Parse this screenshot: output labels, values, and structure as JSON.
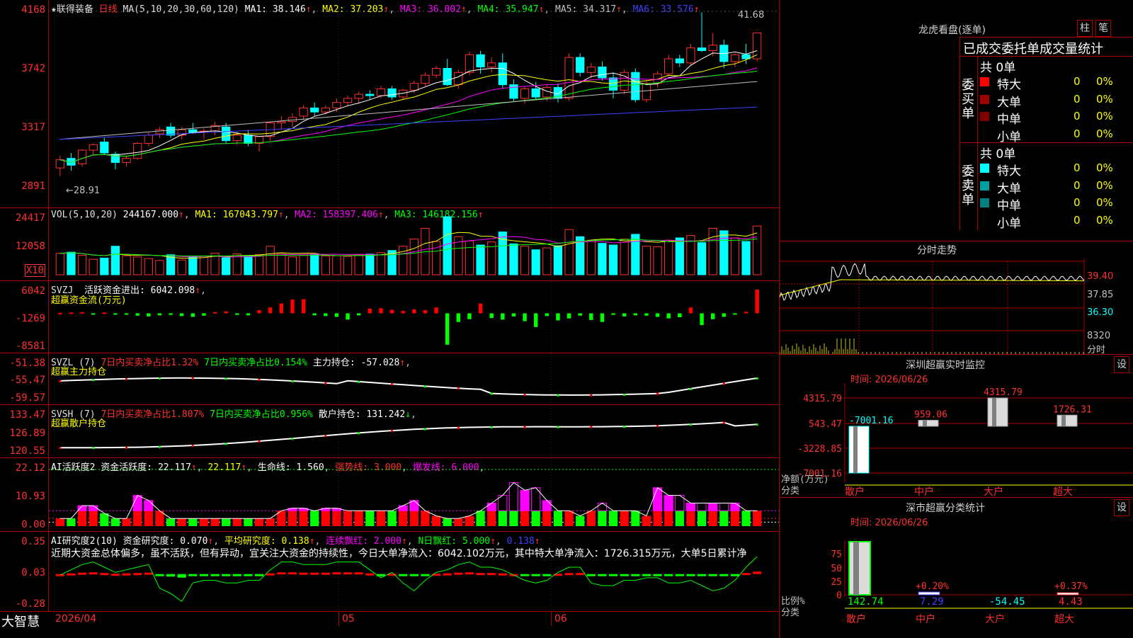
{
  "stock": {
    "name": "★联得装备",
    "period": "日线"
  },
  "ma_header": {
    "label": "MA(5,10,20,30,60,120)",
    "items": [
      {
        "text": "MA1: 38.146",
        "color": "#ffffff"
      },
      {
        "text": "MA2: 37.203",
        "color": "#ffff00"
      },
      {
        "text": "MA3: 36.002",
        "color": "#ff00ff"
      },
      {
        "text": "MA4: 35.947",
        "color": "#00ff00"
      },
      {
        "text": "MA5: 34.317",
        "color": "#c0c0c0"
      },
      {
        "text": "MA6: 33.576",
        "color": "#4040ff"
      }
    ],
    "high_label": "41.68",
    "low_label": "←28.91"
  },
  "price_axis": [
    "4168",
    "3742",
    "3317",
    "2891"
  ],
  "vol_header": {
    "label": "VOL(5,10,20)",
    "value": "244167.000",
    "ma1": "MA1: 167043.797",
    "ma2": "MA2: 158397.406",
    "ma3": "MA3: 146182.156"
  },
  "vol_axis": [
    "24417",
    "12058"
  ],
  "vol_unit": "X10",
  "svzj": {
    "label": "SVZJ",
    "line": "活跃资金进出: 6042.098",
    "sub": "超赢资金流(万元)",
    "axis": [
      "6042",
      "-1269",
      "-8581"
    ]
  },
  "svzl": {
    "label": "SVZL (7)",
    "a": "7日内买卖净占比1.32%",
    "b": "7日内买卖净占比0.154%",
    "c": "主力持仓: -57.028",
    "sub": "超赢主力持仓",
    "axis": [
      "-51.38",
      "-55.47",
      "-59.57"
    ]
  },
  "svsh": {
    "label": "SVSH (7)",
    "a": "7日内买卖净占比1.807%",
    "b": "7日内买卖净占比0.956%",
    "c": "散户持仓: 131.242",
    "sub": "超赢散户持仓",
    "axis": [
      "133.47",
      "126.89",
      "120.55"
    ]
  },
  "ai1": {
    "label": "AI活跃度2 资金活跃度: 22.117",
    "v2": "22.117",
    "life": "生命线: 1.560",
    "strong": "强势线: 3.000",
    "burst": "爆发线: 6.000",
    "axis": [
      "22.12",
      "10.93",
      "0.00"
    ]
  },
  "ai2": {
    "label": "AI研究度2(10) 资金研究度: 0.070",
    "avg": "平均研究度: 0.138",
    "cont": "连续飘红: 2.000",
    "n": "N日飘红: 5.000",
    "last": "0.138",
    "axis": [
      "0.35",
      "0.03",
      "-0.28"
    ],
    "text": "近期大资金总体偏多，虽不活跃，但有异动，宜关注大资金的持续性，今日大单净流入：6042.102万元，其中特大单净流入：1726.315万元，大单5日累计净"
  },
  "bottom": {
    "brand": "大智慧",
    "date": "2026/04",
    "m1": "05",
    "m2": "06"
  },
  "lhb": {
    "title": "龙虎看盘(逐单)",
    "btn1": "柱",
    "btn2": "笔",
    "header": "已成交委托单成交量统计",
    "buy_label": "委买单",
    "sell_label": "委卖单",
    "buy_total": "共 0单",
    "sell_total": "共 0单",
    "buy_rows": [
      {
        "name": "特大",
        "n": "0",
        "p": "0%",
        "color": "#ff0000"
      },
      {
        "name": "大单",
        "n": "0",
        "p": "0%",
        "color": "#a00000"
      },
      {
        "name": "中单",
        "n": "0",
        "p": "0%",
        "color": "#800000"
      },
      {
        "name": "小单",
        "n": "0",
        "p": "0%",
        "color": "#000000"
      }
    ],
    "sell_rows": [
      {
        "name": "特大",
        "n": "0",
        "p": "0%",
        "color": "#00ffff"
      },
      {
        "name": "大单",
        "n": "0",
        "p": "0%",
        "color": "#00a0a0"
      },
      {
        "name": "中单",
        "n": "0",
        "p": "0%",
        "color": "#008080"
      },
      {
        "name": "小单",
        "n": "0",
        "p": "0%",
        "color": "#000000"
      }
    ]
  },
  "intraday": {
    "title": "分时走势",
    "axis": [
      "39.40",
      "37.85",
      "36.30"
    ],
    "vol": "8320",
    "vol_label": "分时"
  },
  "sz_monitor": {
    "title": "深圳超赢实时监控",
    "btn": "设",
    "time": "时间: 2026/06/26",
    "axis": [
      "4315.79",
      "543.47",
      "-3228.85",
      "-7001.16"
    ],
    "unit1": "净额(万元)",
    "unit2": "分类",
    "cats": [
      "散户",
      "中户",
      "大户",
      "超大"
    ],
    "values": [
      -7001.16,
      959.06,
      4315.79,
      1726.31
    ],
    "labels": [
      "-7001.16",
      "959.06",
      "4315.79",
      "1726.31"
    ]
  },
  "sz_class": {
    "title": "深市超赢分类统计",
    "btn": "设",
    "time": "时间: 2026/06/26",
    "axis": [
      "75",
      "50",
      "25",
      "0"
    ],
    "unit1": "比例%",
    "unit2": "分类",
    "cats": [
      "散户",
      "中户",
      "大户",
      "超大"
    ],
    "bar_labels": [
      "",
      "+0.20%",
      "",
      "+0.37%"
    ],
    "bottom_values": [
      "142.74",
      "7.29",
      "-54.45",
      "4.43"
    ]
  },
  "chart_data": {
    "type": "candlestick",
    "x_labels": [
      "2026/04",
      "05",
      "06"
    ],
    "price": {
      "ylim": [
        28.91,
        41.68
      ],
      "ohlc": [
        [
          30.2,
          31.1,
          29.6,
          30.8
        ],
        [
          30.9,
          31.3,
          30.0,
          30.4
        ],
        [
          30.5,
          31.6,
          30.3,
          31.5
        ],
        [
          31.5,
          32.0,
          31.2,
          31.9
        ],
        [
          32.1,
          32.4,
          31.2,
          31.3
        ],
        [
          31.2,
          31.4,
          30.1,
          30.6
        ],
        [
          30.6,
          31.1,
          30.3,
          30.9
        ],
        [
          30.9,
          32.1,
          30.8,
          32.0
        ],
        [
          32.0,
          32.8,
          31.8,
          32.6
        ],
        [
          32.7,
          33.2,
          32.4,
          33.0
        ],
        [
          33.2,
          33.5,
          32.4,
          32.6
        ],
        [
          32.6,
          33.2,
          32.3,
          33.0
        ],
        [
          33.0,
          33.5,
          32.7,
          32.8
        ],
        [
          32.8,
          33.1,
          32.3,
          32.9
        ],
        [
          32.9,
          33.6,
          32.6,
          33.3
        ],
        [
          33.2,
          33.5,
          32.0,
          32.2
        ],
        [
          32.2,
          32.7,
          31.9,
          32.6
        ],
        [
          32.6,
          33.0,
          31.8,
          32.0
        ],
        [
          32.0,
          32.4,
          31.4,
          32.5
        ],
        [
          32.5,
          33.6,
          32.2,
          33.5
        ],
        [
          33.5,
          34.0,
          33.0,
          33.6
        ],
        [
          33.6,
          34.2,
          33.2,
          33.9
        ],
        [
          34.0,
          34.8,
          33.7,
          34.6
        ],
        [
          34.6,
          35.0,
          34.0,
          34.3
        ],
        [
          34.3,
          34.8,
          34.1,
          34.6
        ],
        [
          34.6,
          35.3,
          34.3,
          35.0
        ],
        [
          35.0,
          35.5,
          34.7,
          35.3
        ],
        [
          35.3,
          35.8,
          35.0,
          35.6
        ],
        [
          35.6,
          35.9,
          35.2,
          35.5
        ],
        [
          35.5,
          36.2,
          35.3,
          36.0
        ],
        [
          36.0,
          36.2,
          35.2,
          35.4
        ],
        [
          35.4,
          36.0,
          35.2,
          35.9
        ],
        [
          35.9,
          36.6,
          35.7,
          36.4
        ],
        [
          36.4,
          37.2,
          36.2,
          37.0
        ],
        [
          37.0,
          37.7,
          36.8,
          37.5
        ],
        [
          37.5,
          38.2,
          36.2,
          36.3
        ],
        [
          36.3,
          37.4,
          36.0,
          37.2
        ],
        [
          37.2,
          38.7,
          37.0,
          38.5
        ],
        [
          38.5,
          38.8,
          37.1,
          37.6
        ],
        [
          37.6,
          38.3,
          37.2,
          37.9
        ],
        [
          37.9,
          38.6,
          36.0,
          36.3
        ],
        [
          36.3,
          36.7,
          35.1,
          35.3
        ],
        [
          35.3,
          36.2,
          34.9,
          36.0
        ],
        [
          36.0,
          36.5,
          35.2,
          35.4
        ],
        [
          35.4,
          36.3,
          35.1,
          36.1
        ],
        [
          36.1,
          36.4,
          35.0,
          35.3
        ],
        [
          35.3,
          38.6,
          35.1,
          38.3
        ],
        [
          38.3,
          38.6,
          36.9,
          37.2
        ],
        [
          37.2,
          37.9,
          36.8,
          37.6
        ],
        [
          37.6,
          38.0,
          36.6,
          36.8
        ],
        [
          36.8,
          37.2,
          35.3,
          35.9
        ],
        [
          35.9,
          37.4,
          35.6,
          37.2
        ],
        [
          37.2,
          37.5,
          35.0,
          35.2
        ],
        [
          35.2,
          36.6,
          35.0,
          36.4
        ],
        [
          36.4,
          37.3,
          36.1,
          37.1
        ],
        [
          37.1,
          38.5,
          36.9,
          38.2
        ],
        [
          38.2,
          38.5,
          37.6,
          37.9
        ],
        [
          37.9,
          39.3,
          37.7,
          39.0
        ],
        [
          39.0,
          41.6,
          38.7,
          38.8
        ],
        [
          38.8,
          40.1,
          38.4,
          39.2
        ],
        [
          39.2,
          39.6,
          37.5,
          38.0
        ],
        [
          38.0,
          38.6,
          37.6,
          38.5
        ],
        [
          38.5,
          39.3,
          37.8,
          38.2
        ],
        [
          38.2,
          39.9,
          38.0,
          40.1
        ]
      ]
    },
    "volume": {
      "ylim": [
        0,
        24417
      ],
      "values": [
        9000,
        9500,
        8200,
        6500,
        7000,
        12000,
        8000,
        7500,
        6800,
        6000,
        8400,
        6200,
        7600,
        7800,
        9000,
        7200,
        8800,
        7800,
        8500,
        12000,
        9000,
        7500,
        8200,
        8600,
        7900,
        8000,
        7700,
        8500,
        8700,
        9300,
        10200,
        12000,
        15000,
        19500,
        14000,
        24417,
        16000,
        14200,
        12500,
        13800,
        18000,
        13000,
        12000,
        10500,
        11300,
        12200,
        19000,
        16000,
        14500,
        13200,
        12500,
        15000,
        17000,
        12000,
        11800,
        14500,
        15500,
        16500,
        13500,
        19500,
        18500,
        15500,
        14000,
        20500
      ]
    },
    "svzj": {
      "ylim": [
        -8581,
        6042
      ],
      "values": [
        100,
        200,
        300,
        -100,
        200,
        -200,
        -300,
        -600,
        -800,
        -500,
        -400,
        -700,
        -900,
        -600,
        300,
        500,
        -400,
        -500,
        800,
        1500,
        2500,
        3500,
        3600,
        -500,
        -700,
        -900,
        -1600,
        -500,
        1200,
        1300,
        900,
        600,
        1000,
        800,
        1500,
        -8000,
        -2200,
        -1500,
        2500,
        -1200,
        -1600,
        -800,
        -2000,
        -3500,
        -700,
        -1800,
        -1300,
        -600,
        -1700,
        -2200,
        -400,
        -800,
        -500,
        -600,
        -900,
        -1300,
        -1000,
        1500,
        -3000,
        -1500,
        -900,
        -300,
        400,
        6042
      ]
    },
    "svzl": {
      "ylim": [
        -59.57,
        -51.38
      ]
    },
    "svsh": {
      "ylim": [
        120.55,
        133.47
      ]
    },
    "ai_activity": {
      "ylim": [
        0,
        22.12
      ],
      "values": [
        3,
        3,
        8,
        8,
        5,
        3,
        3,
        12,
        10,
        6,
        3,
        3,
        3,
        3,
        3,
        3,
        3,
        3,
        3,
        3,
        6,
        7,
        7,
        6,
        7,
        7,
        6,
        6,
        6,
        6,
        6,
        8,
        10,
        6,
        4,
        3,
        3,
        4,
        6,
        9,
        12,
        17,
        14,
        15,
        10,
        6,
        6,
        4,
        6,
        9,
        6,
        6,
        6,
        4,
        15,
        12,
        12,
        9,
        9,
        9,
        9,
        9,
        6,
        6
      ]
    },
    "ai_research": {
      "ylim": [
        -0.28,
        0.35
      ],
      "values": [
        0.0,
        0.02,
        0.04,
        0.05,
        0.03,
        0.01,
        0.02,
        0.03,
        0.04,
        -0.05,
        -0.07,
        -0.1,
        -0.03,
        -0.02,
        -0.02,
        -0.03,
        -0.03,
        -0.02,
        -0.02,
        0.02,
        0.05,
        0.05,
        0.04,
        0.04,
        0.04,
        0.05,
        0.05,
        0.05,
        0.02,
        -0.01,
        0.01,
        -0.03,
        -0.06,
        -0.02,
        0.01,
        0.02,
        0.04,
        0.05,
        0.03,
        0.03,
        0.02,
        0.0,
        -0.02,
        -0.03,
        -0.02,
        0.01,
        0.03,
        0.03,
        -0.03,
        -0.04,
        -0.04,
        -0.02,
        -0.02,
        -0.01,
        -0.01,
        -0.03,
        -0.03,
        -0.02,
        -0.04,
        -0.06,
        -0.05,
        -0.02,
        0.03,
        0.07
      ]
    },
    "sz_monitor": {
      "categories": [
        "散户",
        "中户",
        "大户",
        "超大"
      ],
      "values": [
        -7001.16,
        959.06,
        4315.79,
        1726.31
      ],
      "ylim": [
        -7001.16,
        4315.79
      ]
    },
    "sz_class": {
      "categories": [
        "散户",
        "中户",
        "大户",
        "超大"
      ],
      "values": [
        142.74,
        0.2,
        -54.45,
        0.37
      ],
      "ylim": [
        0,
        75
      ]
    }
  }
}
